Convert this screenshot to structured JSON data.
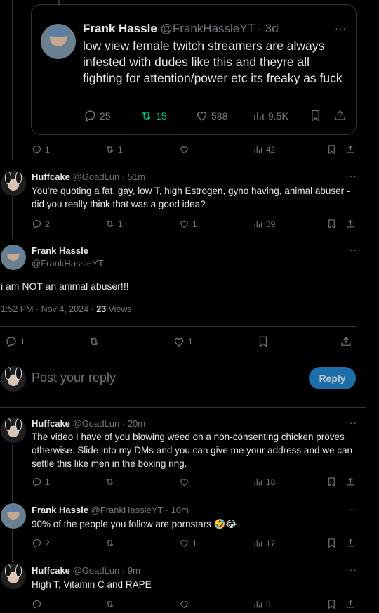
{
  "quoted": {
    "name": "Frank Hassle",
    "handle": "@FrankHassleYT",
    "time": "· 3d",
    "text": "low view female twitch streamers are always infested with dudes like this and theyre all fighting for attention/power etc its freaky as fuck",
    "replies": "25",
    "reposts": "15",
    "likes": "588",
    "views": "9.5K"
  },
  "post1_stats": {
    "replies": "1",
    "reposts": "1",
    "likes": "",
    "views": "42"
  },
  "reply1": {
    "name": "Huffcake",
    "handle": "@GoadLun",
    "time": "· 51m",
    "text": "You're quoting a fat, gay, low T, high Estrogen, gyno having, animal abuser - did you really think that was a good idea?",
    "replies": "2",
    "reposts": "1",
    "likes": "1",
    "views": "39"
  },
  "main": {
    "name": "Frank Hassle",
    "handle": "@FrankHassleYT",
    "text": "i am NOT an animal abuser!!!",
    "timestamp": "1:52 PM · Nov 4, 2024 · ",
    "views_count": "23",
    "views_label": " Views",
    "replies": "1",
    "likes": "1"
  },
  "composer": {
    "placeholder": "Post your reply",
    "button": "Reply"
  },
  "reply2": {
    "name": "Huffcake",
    "handle": "@GoadLun",
    "time": "· 20m",
    "text": "The video I have of you blowing weed on a non-consenting chicken proves otherwise. Slide into my DMs and you can give me your address and we can settle this like men in the boxing ring.",
    "replies": "1",
    "views": "18"
  },
  "reply3": {
    "name": "Frank Hassle",
    "handle": "@FrankHassleYT",
    "time": "· 10m",
    "text": "90% of the people you follow are pornstars 🤣😂",
    "replies": "2",
    "likes": "1",
    "views": "17"
  },
  "reply4": {
    "name": "Huffcake",
    "handle": "@GoadLun",
    "time": "· 9m",
    "text": "High T, Vitamin C and RAPE",
    "views": "9"
  },
  "more_glyph": "···",
  "icons": [
    "reply-icon",
    "repost-icon",
    "like-icon",
    "views-icon",
    "bookmark-icon",
    "share-icon",
    "more-icon"
  ]
}
